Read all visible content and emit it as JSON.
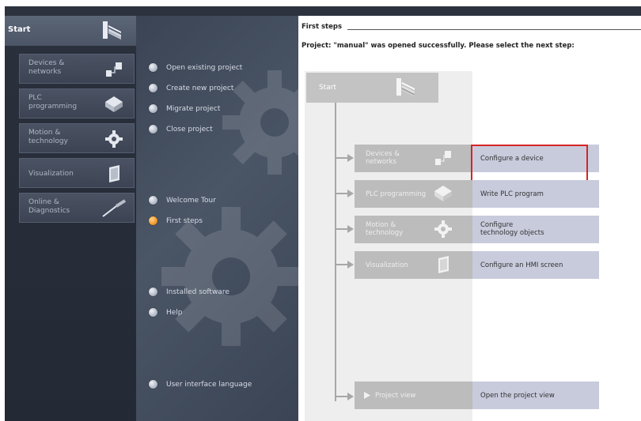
{
  "nav": {
    "start_label": "Start",
    "items": [
      {
        "label": "Devices &\nnetworks",
        "icon": "devices-networks-icon"
      },
      {
        "label": "PLC\nprogramming",
        "icon": "plc-programming-icon"
      },
      {
        "label": "Motion &\ntechnology",
        "icon": "motion-technology-icon"
      },
      {
        "label": "Visualization",
        "icon": "visualization-icon"
      },
      {
        "label": "Online &\nDiagnostics",
        "icon": "online-diagnostics-icon"
      }
    ]
  },
  "actions": {
    "open_existing": "Open existing project",
    "create_new": "Create new project",
    "migrate": "Migrate project",
    "close": "Close project",
    "welcome_tour": "Welcome Tour",
    "first_steps": "First steps",
    "installed_software": "Installed software",
    "help": "Help",
    "ui_language": "User interface language"
  },
  "content": {
    "title": "First steps",
    "message": "Project: \"manual\" was opened successfully. Please select the next step:",
    "flow_start": "Start",
    "steps": [
      {
        "label": "Devices &\nnetworks",
        "option": "Configure a device"
      },
      {
        "label": "PLC programming",
        "option": "Write PLC program"
      },
      {
        "label": "Motion &\ntechnology",
        "option": "Configure\ntechnology objects"
      },
      {
        "label": "Visualization",
        "option": "Configure an HMI screen"
      }
    ],
    "project_view_label": "Project view",
    "project_view_option": "Open the project view"
  },
  "colors": {
    "highlight": "#d62424",
    "active_dot": "#f29a2e"
  }
}
